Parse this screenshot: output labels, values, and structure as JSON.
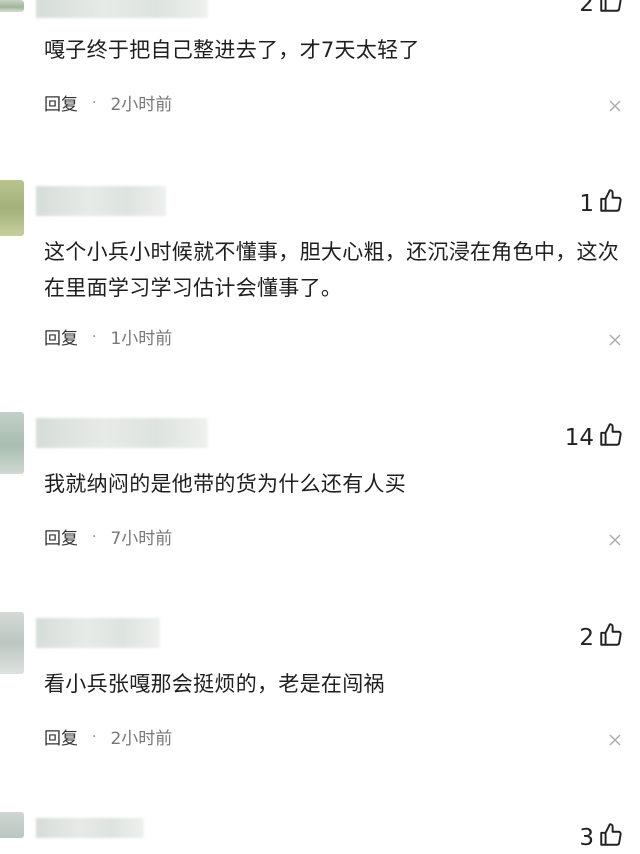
{
  "comments": [
    {
      "likes": "2",
      "text": "嘎子终于把自己整进去了，才7天太轻了",
      "reply_label": "回复",
      "dot": "·",
      "time": "2小时前"
    },
    {
      "likes": "1",
      "text": "这个小兵小时候就不懂事，胆大心粗，还沉浸在角色中，这次在里面学习学习估计会懂事了。",
      "reply_label": "回复",
      "dot": "·",
      "time": "1小时前"
    },
    {
      "likes": "14",
      "text": "我就纳闷的是他带的货为什么还有人买",
      "reply_label": "回复",
      "dot": "·",
      "time": "7小时前"
    },
    {
      "likes": "2",
      "text": "看小兵张嘎那会挺烦的，老是在闯祸",
      "reply_label": "回复",
      "dot": "·",
      "time": "2小时前"
    },
    {
      "likes": "3",
      "text": "",
      "reply_label": "",
      "dot": "",
      "time": ""
    }
  ],
  "icons": {
    "like": "thumbs-up-icon",
    "close": "close-icon"
  }
}
